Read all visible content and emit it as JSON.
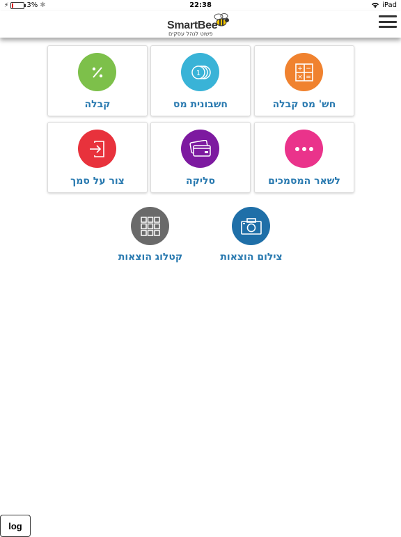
{
  "status_bar": {
    "battery_percent": "3%",
    "battery_level": 0.03,
    "time": "22:38",
    "device": "iPad"
  },
  "header": {
    "logo_text": "SmartBee",
    "slogan": "פשוט לנהל עסקים",
    "menu_icon": "hamburger-icon"
  },
  "tiles": [
    {
      "label": "חש' מס קבלה",
      "color": "#f0822f",
      "icon": "calculator-icon"
    },
    {
      "label": "חשבונית מס",
      "color": "#39b3d7",
      "icon": "coins-icon"
    },
    {
      "label": "קבלה",
      "color": "#7dc04a",
      "icon": "percent-icon"
    },
    {
      "label": "לשאר המסמכים",
      "color": "#ea338b",
      "icon": "more-icon"
    },
    {
      "label": "סליקה",
      "color": "#7d1aa0",
      "icon": "credit-card-icon"
    },
    {
      "label": "צור על סמך",
      "color": "#e8323c",
      "icon": "export-icon"
    }
  ],
  "extra_actions": [
    {
      "label": "צילום הוצאות",
      "color": "#1f6fa8",
      "icon": "camera-icon"
    },
    {
      "label": "קטלוג הוצאות",
      "color": "#6a6a6a",
      "icon": "grid-icon"
    }
  ],
  "log_button": "log"
}
